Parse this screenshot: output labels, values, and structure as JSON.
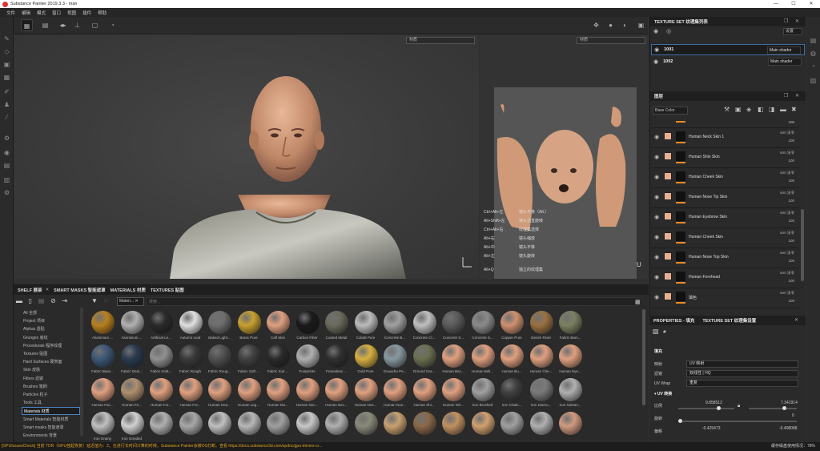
{
  "window": {
    "title": "Substance Painter 2019.3.3 - man",
    "controls": [
      "—",
      "☐",
      "✕"
    ]
  },
  "menu": [
    "文件",
    "编辑",
    "模式",
    "窗口",
    "视图",
    "插件",
    "帮助"
  ],
  "viewport": {
    "left_select": "材质",
    "right_select": "材质"
  },
  "shortcuts": [
    [
      "Ctrl+Alt+左",
      "镜头平移（Alt.）"
    ],
    [
      "Alt+Shift+左",
      "镜头沿直旋转"
    ],
    [
      "Ctrl+Alt+右",
      "纹理集选择"
    ],
    [
      "Alt+右",
      "镜头缩放"
    ],
    [
      "Alt+中",
      "镜头平移"
    ],
    [
      "Alt+左",
      "镜头旋转"
    ],
    [
      "Alt+Q",
      "独立的纹理集"
    ]
  ],
  "texture_set": {
    "title": "TEXTURE SET 纹理集列表",
    "settings": "设置",
    "rows": [
      {
        "name": "1001",
        "shader": "Main shader"
      },
      {
        "name": "1002",
        "shader": "Main shader"
      }
    ]
  },
  "layers": {
    "title": "图层",
    "channel": "Base Color",
    "items": [
      {
        "name": "Human Neck Skin 1",
        "blend": "orm 法令",
        "opacity": "100"
      },
      {
        "name": "Human Shin Skin",
        "blend": "orm 法令",
        "opacity": "100"
      },
      {
        "name": "Human Cheek Skin",
        "blend": "orm 法令",
        "opacity": "100"
      },
      {
        "name": "Human Nose Tip Skin",
        "blend": "orm 法令",
        "opacity": "100"
      },
      {
        "name": "Human Eyebrow Skin",
        "blend": "orm 法令",
        "opacity": "100"
      },
      {
        "name": "Human Cheek Skin",
        "blend": "orm 法令",
        "opacity": "100"
      },
      {
        "name": "Human Nose Top Skin",
        "blend": "orm 法令",
        "opacity": "100"
      },
      {
        "name": "Human Forehead",
        "blend": "orm 法令",
        "opacity": "100"
      },
      {
        "name": "填色",
        "blend": "orm 法令",
        "opacity": "100"
      }
    ],
    "top_opacity": "100"
  },
  "properties": {
    "tab1": "PROPERTIES - 填充",
    "tab2": "TEXTURE SET 纹理集设置",
    "section": "填充",
    "mapping_label": "映射",
    "mapping": "UV 映射",
    "filter_label": "滤镜",
    "filter": "双线性 | HQ",
    "wrap_label": "UV Wrap",
    "wrap": "重复",
    "uv_section": "UV 转换",
    "scale_label": "比例",
    "scale_x": "9.858512",
    "scale_y": "7.341914",
    "rot_label": "旋转",
    "rot": "0",
    "offset_label": "偏移",
    "off_x": "-0.425473",
    "off_y": "-0.408088"
  },
  "shelf": {
    "tabs": [
      "SHELF 展架",
      "SMART MASKS 智能遮罩",
      "MATERIALS 材质",
      "TEXTURES 贴图"
    ],
    "categories": [
      "All 全部",
      "Project 项目",
      "Alphas 透贴",
      "Grunges 底纹",
      "Procedurals 程序纹理",
      "Textures 贴图",
      "Hard Surfaces 硬表面",
      "Skin 皮肤",
      "Filters 滤镜",
      "Brushes 笔刷",
      "Particles 粒子",
      "Tools 工具",
      "Materials 材质",
      "Smart Materials 智能材质",
      "Smart masks 智能遮罩",
      "Environments 背景"
    ],
    "selected": "Materials 材质",
    "filter_chip": "Materi...",
    "search_placeholder": "搜索...",
    "materials": [
      {
        "n": "Aluminium ...",
        "c": "#b8801e"
      },
      {
        "n": "Aluminium ...",
        "c": "#b0b0b0"
      },
      {
        "n": "Artificial Le...",
        "c": "#2a2a2a"
      },
      {
        "n": "Autumn Leaf",
        "c": "#e0e0e0"
      },
      {
        "n": "Baked Light...",
        "c": "#6e6e6e"
      },
      {
        "n": "Brass Pure",
        "c": "#c8a030"
      },
      {
        "n": "Calf Skin",
        "c": "#e0a080"
      },
      {
        "n": "Carbon Fiber",
        "c": "#1a1a1a"
      },
      {
        "n": "Coated Metal",
        "c": "#6a6a5c"
      },
      {
        "n": "Cobalt Pure",
        "c": "#bcbcbc"
      },
      {
        "n": "Concrete B...",
        "c": "#a0a0a0"
      },
      {
        "n": "Concrete Cl...",
        "c": "#c0c0c0"
      },
      {
        "n": "Concrete S...",
        "c": "#5a5a5a"
      },
      {
        "n": "Concrete S...",
        "c": "#8a8a8a"
      },
      {
        "n": "Copper Pure",
        "c": "#d09070"
      },
      {
        "n": "Denim Rivet",
        "c": "#9a7040"
      },
      {
        "n": "Fabric Bam...",
        "c": "#7a8060"
      },
      {
        "n": "Fabric Base...",
        "c": "#3c5878"
      },
      {
        "n": "Fabric Deni...",
        "c": "#2a3a50"
      },
      {
        "n": "Fabric Knitt...",
        "c": "#909090"
      },
      {
        "n": "Fabric Rough",
        "c": "#3a3a3a"
      },
      {
        "n": "Fabric Roug...",
        "c": "#505050"
      },
      {
        "n": "Fabric Soft ...",
        "c": "#404040"
      },
      {
        "n": "Fabric Suit ...",
        "c": "#2a2a2a"
      },
      {
        "n": "Footprints",
        "c": "#b0b0b0"
      },
      {
        "n": "Frameless ...",
        "c": "#303030"
      },
      {
        "n": "Gold Pure",
        "c": "#d8b040"
      },
      {
        "n": "Gouache Pa...",
        "c": "#8898a0"
      },
      {
        "n": "Ground Gra...",
        "c": "#6a7050"
      },
      {
        "n": "Human Bac...",
        "c": "#e0a080"
      },
      {
        "n": "Human Bell...",
        "c": "#e0a080"
      },
      {
        "n": "Human Bu...",
        "c": "#e0a080"
      },
      {
        "n": "Human Che...",
        "c": "#e0a080"
      },
      {
        "n": "Human Eye...",
        "c": "#e0a080"
      },
      {
        "n": "Human Fac...",
        "c": "#e0a080"
      },
      {
        "n": "Human Fe...",
        "c": "#b09070"
      },
      {
        "n": "Human For...",
        "c": "#e0a080"
      },
      {
        "n": "Human For...",
        "c": "#e0a080"
      },
      {
        "n": "Human Hea...",
        "c": "#e0a080"
      },
      {
        "n": "Human Leg...",
        "c": "#e0a080"
      },
      {
        "n": "Human Mo...",
        "c": "#e0a080"
      },
      {
        "n": "Human Nec...",
        "c": "#e0a080"
      },
      {
        "n": "Human Nec...",
        "c": "#e0a080"
      },
      {
        "n": "Human Nos...",
        "c": "#e0a080"
      },
      {
        "n": "Human Nos...",
        "c": "#e0a080"
      },
      {
        "n": "Human Shi...",
        "c": "#e0a080"
      },
      {
        "n": "Human Wri...",
        "c": "#e0a080"
      },
      {
        "n": "Iron Brushed",
        "c": "#a0a0a0"
      },
      {
        "n": "Iron Chain...",
        "c": "#404040"
      },
      {
        "n": "Iron Diamo...",
        "c": "#7a7a7a"
      },
      {
        "n": "Iron Galvan...",
        "c": "#b0b0b0"
      },
      {
        "n": "Iron Grainy",
        "c": "#c0c0c0"
      },
      {
        "n": "Iron Grinded",
        "c": "#d0d0d0"
      },
      {
        "n": "",
        "c": "#b0b0b0"
      },
      {
        "n": "",
        "c": "#a8a8a8"
      },
      {
        "n": "",
        "c": "#c0c0c0"
      },
      {
        "n": "",
        "c": "#b8b8b8"
      },
      {
        "n": "",
        "c": "#a0a0a0"
      },
      {
        "n": "",
        "c": "#c8c8c8"
      },
      {
        "n": "",
        "c": "#b0b0b0"
      },
      {
        "n": "",
        "c": "#8a8a7a"
      },
      {
        "n": "",
        "c": "#c8a070"
      },
      {
        "n": "",
        "c": "#8a6848"
      },
      {
        "n": "",
        "c": "#c09060"
      },
      {
        "n": "",
        "c": "#d0a070"
      },
      {
        "n": "",
        "c": "#a0a0a0"
      },
      {
        "n": "",
        "c": "#b0b0b0"
      },
      {
        "n": "",
        "c": "#d09a80"
      },
      {
        "n": "",
        "c": "#e0a080"
      },
      {
        "n": "",
        "c": "#e0a080"
      }
    ]
  },
  "status": {
    "text": "[GPUIssuesCheck] 当前 TDR（GPU挂起恢复）延迟值为：2。在进行长时间计算的时候，Substance Painter会被OS打断。查看 https://docs.substance3d.com/spdoc/gpu-drivers-cr...",
    "right": "缓存磁盘使用情况：78%"
  }
}
